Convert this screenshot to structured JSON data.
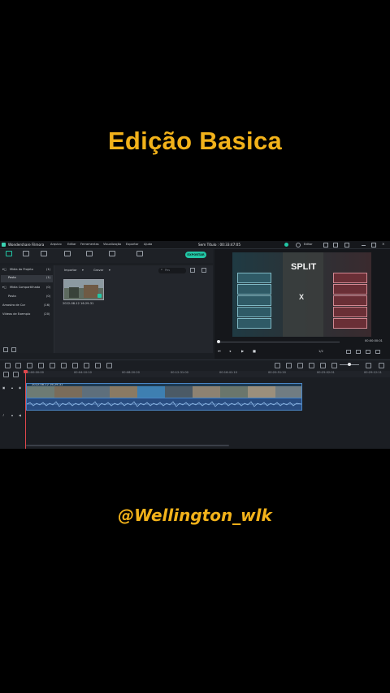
{
  "overlay": {
    "headline": "Edição Basica",
    "handle": "@Wellington_wlk"
  },
  "window": {
    "app_name": "Wondershare Filmora",
    "title": "Sem Título : 00:33:47:05",
    "menu": [
      "Arquivo",
      "Editar",
      "Ferramentas",
      "Visualização",
      "Exportar",
      "Ajuda"
    ],
    "right_buttons": {
      "editor_label": "Editor"
    }
  },
  "toolbar": {
    "tabs": [
      "Mídia",
      "Áudio",
      "Títulos",
      "Transições",
      "Efeitos",
      "Elementos",
      "Tela Dividida"
    ],
    "export_label": "EXPORTAR"
  },
  "sidebar": {
    "items": [
      {
        "label": "Mídia do Projeto",
        "count": "(1)"
      },
      {
        "label": "Pasta",
        "count": "(1)"
      },
      {
        "label": "Mídia Compartilhada",
        "count": "(0)"
      },
      {
        "label": "Pasta",
        "count": "(0)"
      },
      {
        "label": "Amostra de Cor",
        "count": "(16)"
      },
      {
        "label": "Vídeos de Exemplo",
        "count": "(20)"
      }
    ]
  },
  "media": {
    "import_label": "Importar",
    "record_label": "Gravar",
    "search_placeholder": "Pes",
    "clip_name": "2022-08-12 16-29-31"
  },
  "preview": {
    "game_title": "SPLIT",
    "versus": "X",
    "timecode": "00:00:00:01",
    "quality": "1/2"
  },
  "timeline": {
    "ruler_ticks": [
      "00:00:00:00",
      "00:04:10:10",
      "00:08:20:20",
      "00:12:31:00",
      "00:16:41:10",
      "00:20:51:20",
      "00:25:02:01",
      "00:29:12:11"
    ],
    "clip_label": "2022-08-12 16-29-31"
  },
  "colors": {
    "accent": "#22c7a6",
    "overlay_text": "#f2b21a",
    "playhead": "#e0474c",
    "clip_border": "#4a86c5"
  }
}
